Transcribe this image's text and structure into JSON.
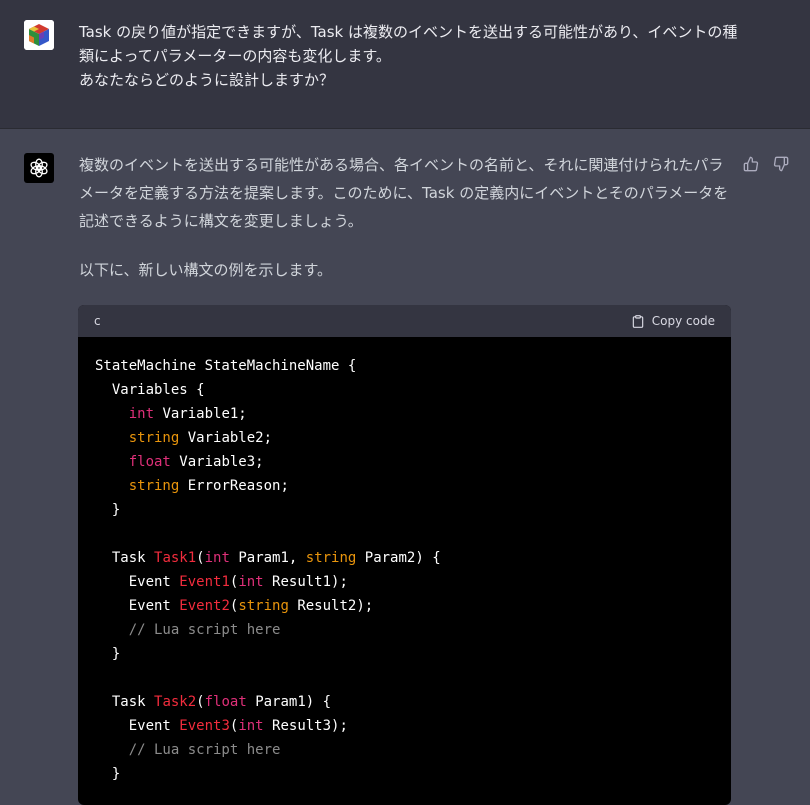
{
  "user_message": {
    "text": "Task の戻り値が指定できますが、Task は複数のイベントを送出する可能性があり、イベントの種類によってパラメーターの内容も変化します。\nあなたならどのように設計しますか？"
  },
  "assistant_message": {
    "paragraph_1": "複数のイベントを送出する可能性がある場合、各イベントの名前と、それに関連付けられたパラメータを定義する方法を提案します。このために、Task の定義内にイベントとそのパラメータを記述できるように構文を変更しましょう。",
    "paragraph_2": "以下に、新しい構文の例を示します。"
  },
  "code_block": {
    "language": "c",
    "copy_label": "Copy code",
    "lines": [
      [
        {
          "t": "StateMachine StateMachineName {",
          "c": ""
        }
      ],
      [
        {
          "t": "  Variables {",
          "c": ""
        }
      ],
      [
        {
          "t": "    ",
          "c": ""
        },
        {
          "t": "int",
          "c": "kw-red"
        },
        {
          "t": " Variable1;",
          "c": ""
        }
      ],
      [
        {
          "t": "    ",
          "c": ""
        },
        {
          "t": "string",
          "c": "kw"
        },
        {
          "t": " Variable2;",
          "c": ""
        }
      ],
      [
        {
          "t": "    ",
          "c": ""
        },
        {
          "t": "float",
          "c": "kw-red"
        },
        {
          "t": " Variable3;",
          "c": ""
        }
      ],
      [
        {
          "t": "    ",
          "c": ""
        },
        {
          "t": "string",
          "c": "kw"
        },
        {
          "t": " ErrorReason;",
          "c": ""
        }
      ],
      [
        {
          "t": "  }",
          "c": ""
        }
      ],
      [
        {
          "t": "",
          "c": ""
        }
      ],
      [
        {
          "t": "  Task ",
          "c": ""
        },
        {
          "t": "Task1",
          "c": "fn"
        },
        {
          "t": "(",
          "c": ""
        },
        {
          "t": "int",
          "c": "kw-red"
        },
        {
          "t": " Param1, ",
          "c": ""
        },
        {
          "t": "string",
          "c": "kw"
        },
        {
          "t": " Param2) {",
          "c": ""
        }
      ],
      [
        {
          "t": "    Event ",
          "c": ""
        },
        {
          "t": "Event1",
          "c": "fn"
        },
        {
          "t": "(",
          "c": ""
        },
        {
          "t": "int",
          "c": "kw-red"
        },
        {
          "t": " Result1);",
          "c": ""
        }
      ],
      [
        {
          "t": "    Event ",
          "c": ""
        },
        {
          "t": "Event2",
          "c": "fn"
        },
        {
          "t": "(",
          "c": ""
        },
        {
          "t": "string",
          "c": "kw"
        },
        {
          "t": " Result2);",
          "c": ""
        }
      ],
      [
        {
          "t": "    // Lua script here",
          "c": "cm"
        }
      ],
      [
        {
          "t": "  }",
          "c": ""
        }
      ],
      [
        {
          "t": "",
          "c": ""
        }
      ],
      [
        {
          "t": "  Task ",
          "c": ""
        },
        {
          "t": "Task2",
          "c": "fn"
        },
        {
          "t": "(",
          "c": ""
        },
        {
          "t": "float",
          "c": "kw-red"
        },
        {
          "t": " Param1) {",
          "c": ""
        }
      ],
      [
        {
          "t": "    Event ",
          "c": ""
        },
        {
          "t": "Event3",
          "c": "fn"
        },
        {
          "t": "(",
          "c": ""
        },
        {
          "t": "int",
          "c": "kw-red"
        },
        {
          "t": " Result3);",
          "c": ""
        }
      ],
      [
        {
          "t": "    // Lua script here",
          "c": "cm"
        }
      ],
      [
        {
          "t": "  }",
          "c": ""
        }
      ]
    ]
  },
  "icons": {
    "user_avatar": "cube-avatar-icon",
    "assistant_avatar": "openai-logo-icon",
    "copy": "clipboard-icon",
    "thumbs_up": "thumbs-up-icon",
    "thumbs_down": "thumbs-down-icon"
  },
  "colors": {
    "user_bg": "#343541",
    "assistant_bg": "#444654",
    "code_bg": "#000000",
    "code_header_bg": "#343541",
    "keyword_orange": "#e9950c",
    "keyword_pink": "#df3079",
    "function_red": "#f22c3d",
    "comment_gray": "#8b8b8b"
  }
}
